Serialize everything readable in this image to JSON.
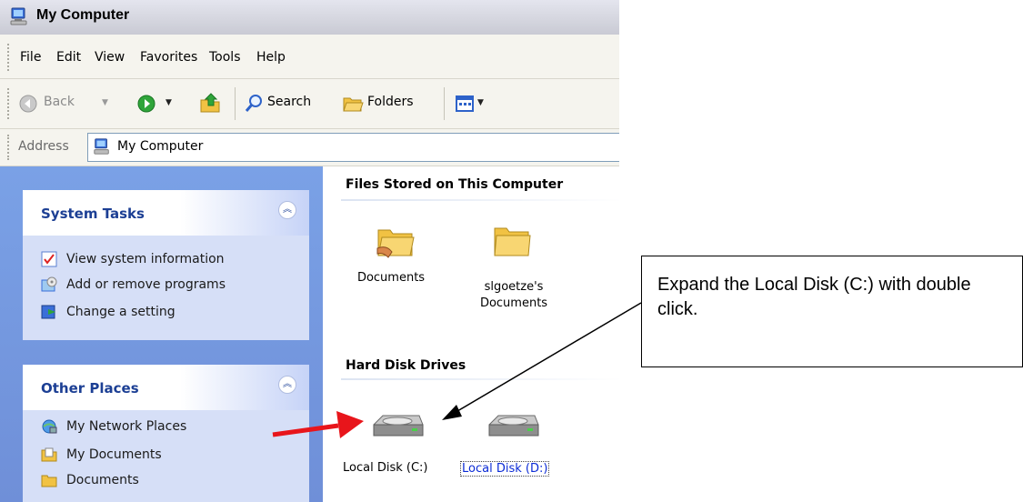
{
  "window": {
    "title": "My Computer"
  },
  "menu": {
    "items": [
      "File",
      "Edit",
      "View",
      "Favorites",
      "Tools",
      "Help"
    ]
  },
  "toolbar": {
    "back_label": "Back",
    "search_label": "Search",
    "folders_label": "Folders"
  },
  "address": {
    "label": "Address",
    "value": "My Computer"
  },
  "sidebar": {
    "system_tasks": {
      "title": "System Tasks",
      "items": [
        "View system information",
        "Add or remove programs",
        "Change a setting"
      ]
    },
    "other_places": {
      "title": "Other Places",
      "items": [
        "My Network Places",
        "My Documents",
        "Documents"
      ]
    }
  },
  "content": {
    "files_section": {
      "title": "Files Stored on This Computer",
      "items": [
        "Documents",
        "slgoetze's Documents"
      ]
    },
    "drives_section": {
      "title": "Hard Disk Drives",
      "items": [
        "Local Disk (C:)",
        "Local Disk (D:)"
      ]
    }
  },
  "callout": {
    "text": "Expand the Local Disk (C:) with double click."
  },
  "colors": {
    "arrow_red": "#e8151b",
    "link_blue": "#0b2bd6",
    "sidebar_blue": "#7aa1e6"
  }
}
